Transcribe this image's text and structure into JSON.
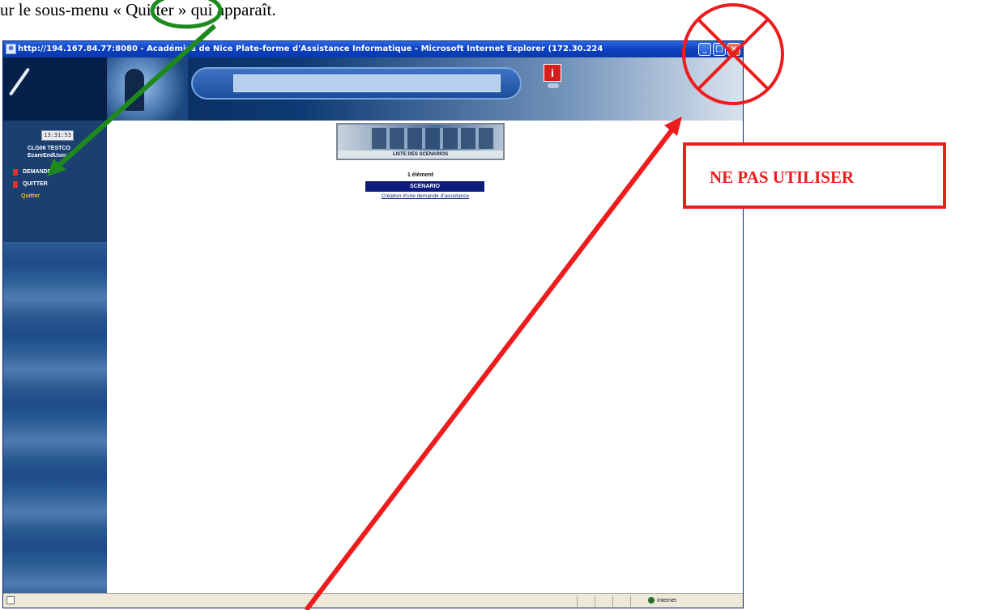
{
  "document": {
    "caption": "ur le sous-menu « Quitter » qui apparaît."
  },
  "browser": {
    "title": "http://194.167.84.77:8080 - Académies de Nice Plate-forme d'Assistance Informatique - Microsoft Internet Explorer (172.30.224",
    "window_buttons": [
      "_",
      "□",
      "×"
    ]
  },
  "sidebar": {
    "clock": "13:31:53",
    "user_line1": "CLG06 TESTCO",
    "user_line2": "EcareEndUser",
    "items": [
      {
        "label": "DEMANDE"
      },
      {
        "label": "QUITTER"
      }
    ],
    "submenu": "Quitter"
  },
  "content": {
    "banner_caption": "LISTE DES SCENARIOS",
    "count": "1 élément",
    "table_header": "SCENARIO",
    "table_rows": [
      "Création d'une demande d'assistance"
    ]
  },
  "statusbar": {
    "zone": "Internet"
  },
  "annotations": {
    "warning": "NE PAS UTILISER",
    "colors": {
      "warning": "#ee1c1c",
      "highlight": "#1e8a1e"
    }
  }
}
